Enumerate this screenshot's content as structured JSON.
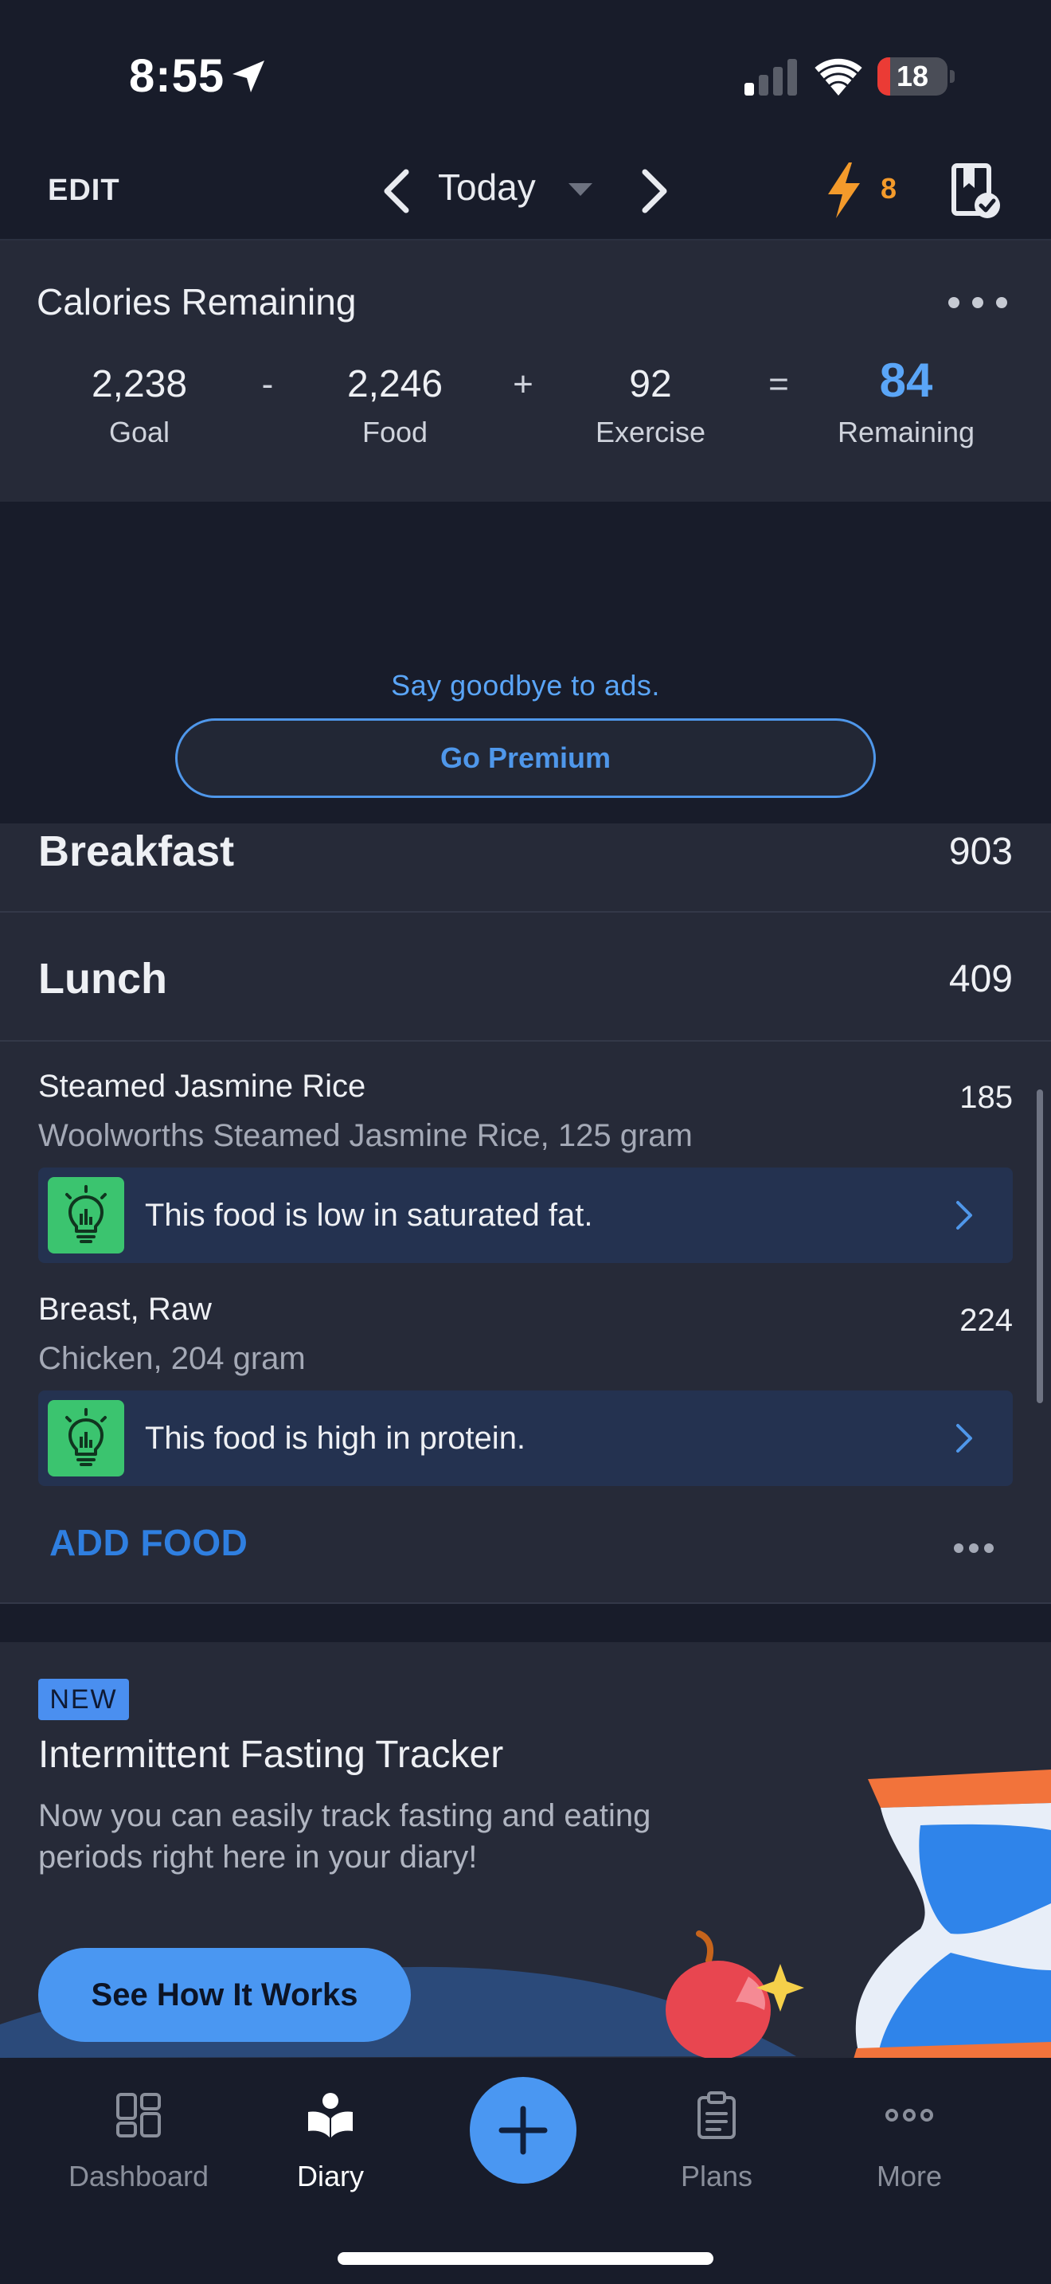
{
  "status_bar": {
    "time": "8:55",
    "battery_level": "18",
    "battery_fraction": 0.18,
    "icons": [
      "location-arrow-icon",
      "cellular-signal-icon",
      "wifi-icon",
      "battery-icon"
    ]
  },
  "header": {
    "edit_label": "EDIT",
    "date_label": "Today",
    "streak_count": "8",
    "icons": [
      "chevron-left-icon",
      "caret-down-icon",
      "chevron-right-icon",
      "lightning-streak-icon",
      "logged-bookmark-icon"
    ]
  },
  "calories": {
    "title": "Calories Remaining",
    "goal_value": "2,238",
    "goal_label": "Goal",
    "op_minus": "-",
    "food_value": "2,246",
    "food_label": "Food",
    "op_plus": "+",
    "exercise_value": "92",
    "exercise_label": "Exercise",
    "op_equals": "=",
    "remaining_value": "84",
    "remaining_label": "Remaining"
  },
  "ad": {
    "text": "Say goodbye to ads.",
    "button_label": "Go Premium"
  },
  "meals": {
    "breakfast": {
      "name": "Breakfast",
      "calories": "903"
    },
    "lunch": {
      "name": "Lunch",
      "calories": "409",
      "items": [
        {
          "name": "Steamed Jasmine Rice",
          "description": "Woolworths Steamed Jasmine Rice, 125 gram",
          "calories": "185",
          "tip": "This food is low in saturated fat."
        },
        {
          "name": "Breast, Raw",
          "description": "Chicken, 204 gram",
          "calories": "224",
          "tip": "This food is high in protein."
        }
      ],
      "add_food_label": "ADD FOOD"
    }
  },
  "promo": {
    "badge": "NEW",
    "title": "Intermittent Fasting Tracker",
    "body": "Now you can easily track fasting and eating periods right here in your diary!",
    "button_label": "See How It Works"
  },
  "tab_bar": {
    "tabs": [
      {
        "label": "Dashboard",
        "icon": "dashboard-grid-icon"
      },
      {
        "label": "Diary",
        "icon": "diary-book-icon",
        "active": true
      },
      {
        "label": "Plans",
        "icon": "clipboard-icon"
      },
      {
        "label": "More",
        "icon": "more-dots-icon"
      }
    ],
    "add_icon": "plus-icon"
  },
  "colors": {
    "background": "#181c2a",
    "card": "#262a38",
    "accent_blue": "#4a97f2",
    "streak_orange": "#f39a2b",
    "tip_green": "#3bc46f",
    "tip_background": "#243250"
  }
}
